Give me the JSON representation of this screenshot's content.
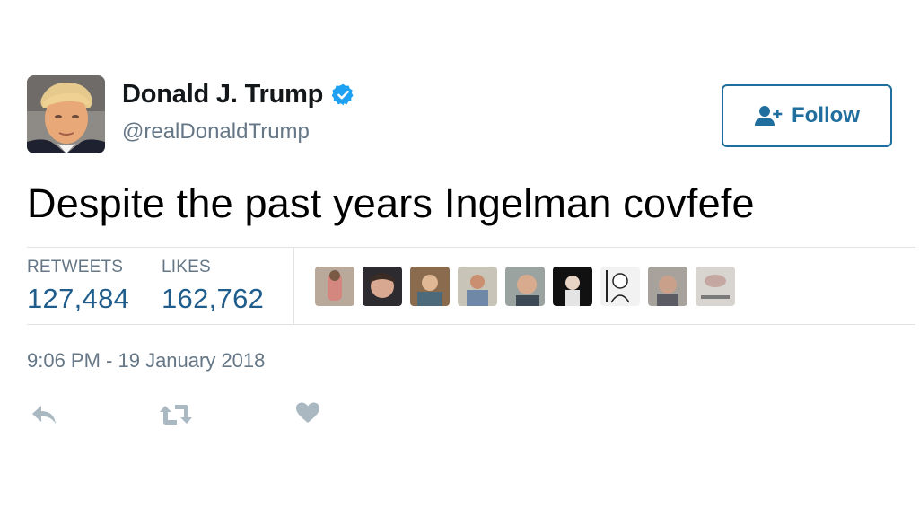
{
  "user": {
    "display_name": "Donald J. Trump",
    "handle": "@realDonaldTrump",
    "verified": true
  },
  "follow_button": {
    "label": "Follow",
    "icon": "follow-user-icon"
  },
  "tweet": {
    "text": "Despite the past years Ingelman covfefe",
    "timestamp": "9:06 PM - 19 January 2018"
  },
  "stats": {
    "retweets_label": "RETWEETS",
    "retweets_value": "127,484",
    "likes_label": "LIKES",
    "likes_value": "162,762"
  },
  "likers": [
    "liker-avatar-1",
    "liker-avatar-2",
    "liker-avatar-3",
    "liker-avatar-4",
    "liker-avatar-5",
    "liker-avatar-6",
    "liker-avatar-7",
    "liker-avatar-8",
    "liker-avatar-9"
  ],
  "actions": [
    "reply-icon",
    "retweet-icon",
    "like-heart-icon"
  ],
  "colors": {
    "accent": "#1f6e9e",
    "stat_value": "#1f5d8c",
    "muted": "#657786",
    "verified": "#1da1f2",
    "action_icon": "#aab8c2"
  }
}
